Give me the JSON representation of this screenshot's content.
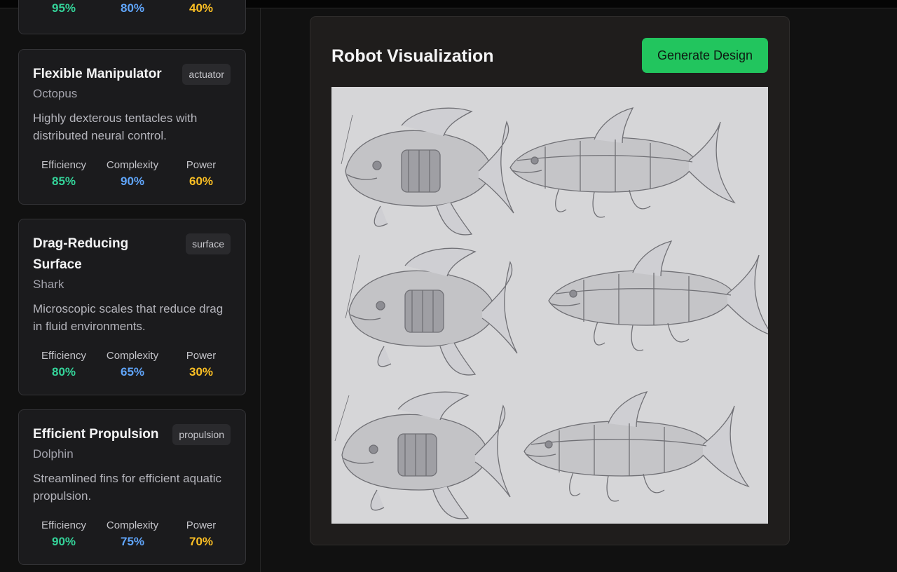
{
  "colors": {
    "efficiency": "#34d399",
    "complexity": "#60a5fa",
    "power": "#fbbf24",
    "accent": "#22c55e"
  },
  "partial_card": {
    "efficiency": "95%",
    "complexity": "80%",
    "power": "40%"
  },
  "cards": [
    {
      "title": "Flexible Manipulator",
      "tag": "actuator",
      "animal": "Octopus",
      "description": "Highly dexterous tentacles with distributed neural control.",
      "stats": [
        {
          "label": "Efficiency",
          "value": "85%"
        },
        {
          "label": "Complexity",
          "value": "90%"
        },
        {
          "label": "Power",
          "value": "60%"
        }
      ]
    },
    {
      "title": "Drag-Reducing Surface",
      "tag": "surface",
      "animal": "Shark",
      "description": "Microscopic scales that reduce drag in fluid environments.",
      "stats": [
        {
          "label": "Efficiency",
          "value": "80%"
        },
        {
          "label": "Complexity",
          "value": "65%"
        },
        {
          "label": "Power",
          "value": "30%"
        }
      ]
    },
    {
      "title": "Efficient Propulsion",
      "tag": "propulsion",
      "animal": "Dolphin",
      "description": "Streamlined fins for efficient aquatic propulsion.",
      "stats": [
        {
          "label": "Efficiency",
          "value": "90%"
        },
        {
          "label": "Complexity",
          "value": "75%"
        },
        {
          "label": "Power",
          "value": "70%"
        }
      ]
    }
  ],
  "panel": {
    "title": "Robot Visualization",
    "button_label": "Generate Design"
  },
  "image": {
    "subject": "robotic-fish-concept-sketches"
  }
}
